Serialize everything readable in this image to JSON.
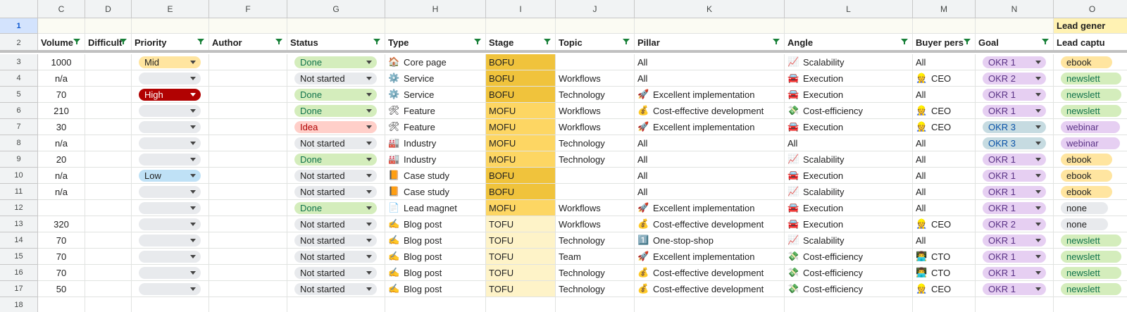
{
  "columns": [
    {
      "letter": "C",
      "header": "Volume"
    },
    {
      "letter": "D",
      "header": "Difficult"
    },
    {
      "letter": "E",
      "header": "Priority"
    },
    {
      "letter": "F",
      "header": "Author"
    },
    {
      "letter": "G",
      "header": "Status"
    },
    {
      "letter": "H",
      "header": "Type"
    },
    {
      "letter": "I",
      "header": "Stage"
    },
    {
      "letter": "J",
      "header": "Topic"
    },
    {
      "letter": "K",
      "header": "Pillar"
    },
    {
      "letter": "L",
      "header": "Angle"
    },
    {
      "letter": "M",
      "header": "Buyer pers"
    },
    {
      "letter": "N",
      "header": "Goal"
    },
    {
      "letter": "O",
      "header": "Lead captu"
    }
  ],
  "row1": {
    "O": "Lead gener"
  },
  "row_numbers": [
    "1",
    "2",
    "3",
    "4",
    "5",
    "6",
    "7",
    "8",
    "9",
    "10",
    "11",
    "12",
    "13",
    "14",
    "15",
    "16",
    "17",
    "18"
  ],
  "colors": {
    "stage_bofu": "#f0c33c",
    "stage_mofu": "#fdd663",
    "stage_tofu": "#fef3c8",
    "done": "#d4edbc",
    "not_started": "#e8eaed",
    "idea": "#ffcfc9",
    "priority_mid": "#ffe5a0",
    "priority_high": "#b10202",
    "priority_low": "#bfe1f6",
    "okr": "#e6cff2",
    "okr_3": "#c6dbe1",
    "ebook": "#ffe5a0",
    "newsletter": "#d4edbc",
    "webinar": "#e6cff2",
    "none": "#e8eaed",
    "header_row_bg": "#e6f4ea",
    "grid_line": "#e1e3e1"
  },
  "rows": [
    {
      "volume": "1000",
      "priority": "Mid",
      "priority_color": "priority_mid",
      "status": "Done",
      "status_color": "done",
      "type_icon": "🏠",
      "type": "Core page",
      "stage": "BOFU",
      "stage_color": "stage_bofu",
      "topic": "",
      "pillar_icon": "",
      "pillar": "All",
      "angle_icon": "📈",
      "angle": "Scalability",
      "buyer_icon": "",
      "buyer": "All",
      "goal": "OKR 1",
      "goal_color": "okr",
      "lead": "ebook",
      "lead_color": "ebook"
    },
    {
      "volume": "n/a",
      "priority": "",
      "priority_color": "not_started",
      "status": "Not started",
      "status_color": "not_started",
      "type_icon": "⚙️",
      "type": "Service",
      "stage": "BOFU",
      "stage_color": "stage_bofu",
      "topic": "Workflows",
      "pillar_icon": "",
      "pillar": "All",
      "angle_icon": "🚘",
      "angle": "Execution",
      "buyer_icon": "👷",
      "buyer": "CEO",
      "goal": "OKR 2",
      "goal_color": "okr",
      "lead": "newslett",
      "lead_color": "newsletter"
    },
    {
      "volume": "70",
      "priority": "High",
      "priority_color": "priority_high",
      "status": "Done",
      "status_color": "done",
      "type_icon": "⚙️",
      "type": "Service",
      "stage": "BOFU",
      "stage_color": "stage_bofu",
      "topic": "Technology",
      "pillar_icon": "🚀",
      "pillar": "Excellent implementation",
      "angle_icon": "🚘",
      "angle": "Execution",
      "buyer_icon": "",
      "buyer": "All",
      "goal": "OKR 1",
      "goal_color": "okr",
      "lead": "newslett",
      "lead_color": "newsletter"
    },
    {
      "volume": "210",
      "priority": "",
      "priority_color": "not_started",
      "status": "Done",
      "status_color": "done",
      "type_icon": "🛠",
      "type": "Feature",
      "stage": "MOFU",
      "stage_color": "stage_mofu",
      "topic": "Workflows",
      "pillar_icon": "💰",
      "pillar": "Cost-effective development",
      "angle_icon": "💸",
      "angle": "Cost-efficiency",
      "buyer_icon": "👷",
      "buyer": "CEO",
      "goal": "OKR 1",
      "goal_color": "okr",
      "lead": "newslett",
      "lead_color": "newsletter"
    },
    {
      "volume": "30",
      "priority": "",
      "priority_color": "not_started",
      "status": "Idea",
      "status_color": "idea",
      "type_icon": "🛠",
      "type": "Feature",
      "stage": "MOFU",
      "stage_color": "stage_mofu",
      "topic": "Workflows",
      "pillar_icon": "🚀",
      "pillar": "Excellent implementation",
      "angle_icon": "🚘",
      "angle": "Execution",
      "buyer_icon": "👷",
      "buyer": "CEO",
      "goal": "OKR 3",
      "goal_color": "okr_3",
      "lead": "webinar",
      "lead_color": "webinar"
    },
    {
      "volume": "n/a",
      "priority": "",
      "priority_color": "not_started",
      "status": "Not started",
      "status_color": "not_started",
      "type_icon": "🏭",
      "type": "Industry",
      "stage": "MOFU",
      "stage_color": "stage_mofu",
      "topic": "Technology",
      "pillar_icon": "",
      "pillar": "All",
      "angle_icon": "",
      "angle": "All",
      "buyer_icon": "",
      "buyer": "All",
      "goal": "OKR 3",
      "goal_color": "okr_3",
      "lead": "webinar",
      "lead_color": "webinar"
    },
    {
      "volume": "20",
      "priority": "",
      "priority_color": "not_started",
      "status": "Done",
      "status_color": "done",
      "type_icon": "🏭",
      "type": "Industry",
      "stage": "MOFU",
      "stage_color": "stage_mofu",
      "topic": "Technology",
      "pillar_icon": "",
      "pillar": "All",
      "angle_icon": "📈",
      "angle": "Scalability",
      "buyer_icon": "",
      "buyer": "All",
      "goal": "OKR 1",
      "goal_color": "okr",
      "lead": "ebook",
      "lead_color": "ebook"
    },
    {
      "volume": "n/a",
      "priority": "Low",
      "priority_color": "priority_low",
      "status": "Not started",
      "status_color": "not_started",
      "type_icon": "📙",
      "type": "Case study",
      "stage": "BOFU",
      "stage_color": "stage_bofu",
      "topic": "",
      "pillar_icon": "",
      "pillar": "All",
      "angle_icon": "🚘",
      "angle": "Execution",
      "buyer_icon": "",
      "buyer": "All",
      "goal": "OKR 1",
      "goal_color": "okr",
      "lead": "ebook",
      "lead_color": "ebook"
    },
    {
      "volume": "n/a",
      "priority": "",
      "priority_color": "not_started",
      "status": "Not started",
      "status_color": "not_started",
      "type_icon": "📙",
      "type": "Case study",
      "stage": "BOFU",
      "stage_color": "stage_bofu",
      "topic": "",
      "pillar_icon": "",
      "pillar": "All",
      "angle_icon": "📈",
      "angle": "Scalability",
      "buyer_icon": "",
      "buyer": "All",
      "goal": "OKR 1",
      "goal_color": "okr",
      "lead": "ebook",
      "lead_color": "ebook"
    },
    {
      "volume": "",
      "priority": "",
      "priority_color": "not_started",
      "status": "Done",
      "status_color": "done",
      "type_icon": "📄",
      "type": "Lead magnet",
      "stage": "MOFU",
      "stage_color": "stage_mofu",
      "topic": "Workflows",
      "pillar_icon": "🚀",
      "pillar": "Excellent implementation",
      "angle_icon": "🚘",
      "angle": "Execution",
      "buyer_icon": "",
      "buyer": "All",
      "goal": "OKR 1",
      "goal_color": "okr",
      "lead": "none",
      "lead_color": "none"
    },
    {
      "volume": "320",
      "priority": "",
      "priority_color": "not_started",
      "status": "Not started",
      "status_color": "not_started",
      "type_icon": "✍️",
      "type": "Blog post",
      "stage": "TOFU",
      "stage_color": "stage_tofu",
      "topic": "Workflows",
      "pillar_icon": "💰",
      "pillar": "Cost-effective development",
      "angle_icon": "🚘",
      "angle": "Execution",
      "buyer_icon": "👷",
      "buyer": "CEO",
      "goal": "OKR 2",
      "goal_color": "okr",
      "lead": "none",
      "lead_color": "none"
    },
    {
      "volume": "70",
      "priority": "",
      "priority_color": "not_started",
      "status": "Not started",
      "status_color": "not_started",
      "type_icon": "✍️",
      "type": "Blog post",
      "stage": "TOFU",
      "stage_color": "stage_tofu",
      "topic": "Technology",
      "pillar_icon": "1️⃣",
      "pillar": "One-stop-shop",
      "angle_icon": "📈",
      "angle": "Scalability",
      "buyer_icon": "",
      "buyer": "All",
      "goal": "OKR 1",
      "goal_color": "okr",
      "lead": "newslett",
      "lead_color": "newsletter"
    },
    {
      "volume": "70",
      "priority": "",
      "priority_color": "not_started",
      "status": "Not started",
      "status_color": "not_started",
      "type_icon": "✍️",
      "type": "Blog post",
      "stage": "TOFU",
      "stage_color": "stage_tofu",
      "topic": "Team",
      "pillar_icon": "🚀",
      "pillar": "Excellent implementation",
      "angle_icon": "💸",
      "angle": "Cost-efficiency",
      "buyer_icon": "👨‍💻",
      "buyer": "CTO",
      "goal": "OKR 1",
      "goal_color": "okr",
      "lead": "newslett",
      "lead_color": "newsletter"
    },
    {
      "volume": "70",
      "priority": "",
      "priority_color": "not_started",
      "status": "Not started",
      "status_color": "not_started",
      "type_icon": "✍️",
      "type": "Blog post",
      "stage": "TOFU",
      "stage_color": "stage_tofu",
      "topic": "Technology",
      "pillar_icon": "💰",
      "pillar": "Cost-effective development",
      "angle_icon": "💸",
      "angle": "Cost-efficiency",
      "buyer_icon": "👨‍💻",
      "buyer": "CTO",
      "goal": "OKR 1",
      "goal_color": "okr",
      "lead": "newslett",
      "lead_color": "newsletter"
    },
    {
      "volume": "50",
      "priority": "",
      "priority_color": "not_started",
      "status": "Not started",
      "status_color": "not_started",
      "type_icon": "✍️",
      "type": "Blog post",
      "stage": "TOFU",
      "stage_color": "stage_tofu",
      "topic": "Technology",
      "pillar_icon": "💰",
      "pillar": "Cost-effective development",
      "angle_icon": "💸",
      "angle": "Cost-efficiency",
      "buyer_icon": "👷",
      "buyer": "CEO",
      "goal": "OKR 1",
      "goal_color": "okr",
      "lead": "newslett",
      "lead_color": "newsletter"
    }
  ]
}
